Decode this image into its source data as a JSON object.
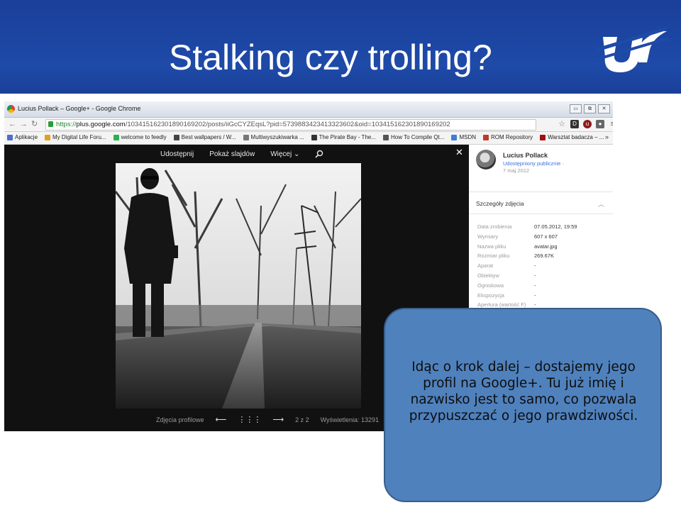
{
  "slide": {
    "title": "Stalking czy trolling?"
  },
  "browser": {
    "window_title": "Lucius Pollack – Google+ - Google Chrome",
    "window_buttons": [
      "▭",
      "⧉",
      "✕"
    ],
    "url": {
      "scheme": "https://",
      "host": "plus.google.com",
      "path": "/103415162301890169202/posts/iiGcCYZEqsL?pid=5739883423413323602&oid=103415162301890169202"
    },
    "bookmarks": [
      {
        "label": "Aplikacje",
        "color": "#4a6fd0"
      },
      {
        "label": "My Digital Life Foru...",
        "color": "#e0a020"
      },
      {
        "label": "welcome to feedly",
        "color": "#2bb24c"
      },
      {
        "label": "Best wallpapers / W...",
        "color": "#444444"
      },
      {
        "label": "Multiwyszukiwarka ...",
        "color": "#777777"
      },
      {
        "label": "The Pirate Bay - The...",
        "color": "#333333"
      },
      {
        "label": "How To Compile Qt...",
        "color": "#555555"
      },
      {
        "label": "MSDN",
        "color": "#3b7dd8"
      },
      {
        "label": "ROM Repository",
        "color": "#c0392b"
      },
      {
        "label": "Warsztat badacza – ...",
        "color": "#a01010"
      }
    ],
    "bookmarks_more": "»"
  },
  "viewer": {
    "toolbar": {
      "share": "Udostępnij",
      "slideshow": "Pokaż slajdów",
      "more": "Więcej ⌄"
    },
    "close": "✕",
    "footer": {
      "album": "Zdjęcia profilowe",
      "counter": "2 z 2",
      "views": "Wyświetlenia: 13291"
    }
  },
  "profile": {
    "name": "Lucius Pollack",
    "visibility": "Udostępniony publicznie ·",
    "date": "7 maj 2012"
  },
  "details": {
    "title": "Szczegóły zdjęcia",
    "rows": [
      {
        "key": "Data zrobienia",
        "value": "07.05.2012, 19:59"
      },
      {
        "key": "Wymiary",
        "value": "607 x 607"
      },
      {
        "key": "Nazwa pliku",
        "value": "avatar.jpg"
      },
      {
        "key": "Rozmiar pliku",
        "value": "269.67K"
      },
      {
        "key": "Aparat",
        "value": "-"
      },
      {
        "key": "Obiektyw",
        "value": "-"
      },
      {
        "key": "Ogniskowa",
        "value": "-"
      },
      {
        "key": "Ekspozycja",
        "value": "-"
      },
      {
        "key": "Apertura (wartość F)",
        "value": "-"
      }
    ]
  },
  "callout": {
    "text": "Idąc o krok dalej – dostajemy jego profil na Google+. Tu już imię i nazwisko jest to samo, co pozwala przypuszczać o jego prawdziwości."
  }
}
